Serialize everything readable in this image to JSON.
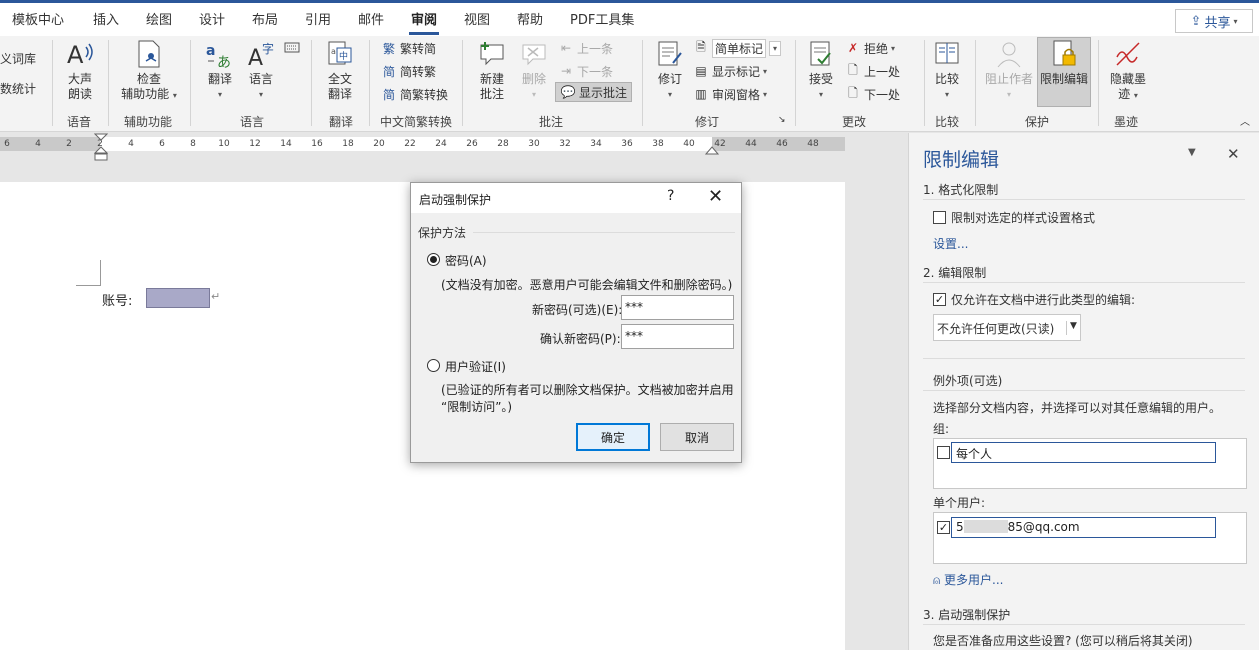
{
  "tabs": [
    "模板中心",
    "插入",
    "绘图",
    "设计",
    "布局",
    "引用",
    "邮件",
    "审阅",
    "视图",
    "帮助",
    "PDF工具集"
  ],
  "active_tab": "审阅",
  "share_label": "共享",
  "ribbon": {
    "left_partial": [
      "义词库",
      "数统计"
    ],
    "speech": {
      "btn": [
        "大声",
        "朗读"
      ],
      "label": "语音"
    },
    "accessibility": {
      "btn": [
        "检查",
        "辅助功能"
      ],
      "label": "辅助功能"
    },
    "language": {
      "translate": "翻译",
      "lang": "语言",
      "label": "语言"
    },
    "translation": {
      "btn": [
        "全文",
        "翻译"
      ],
      "label": "翻译"
    },
    "chinese": {
      "items": [
        "繁转简",
        "简转繁",
        "简繁转换"
      ],
      "label": "中文简繁转换"
    },
    "comments": {
      "new": [
        "新建",
        "批注"
      ],
      "delete": "删除",
      "prev": "上一条",
      "next": "下一条",
      "show": "显示批注",
      "label": "批注"
    },
    "tracking": {
      "track": "修订",
      "markup": "简单标记",
      "show_markup": "显示标记",
      "pane": "审阅窗格",
      "label": "修订"
    },
    "changes": {
      "accept": "接受",
      "reject": "拒绝",
      "prev": "上一处",
      "next": "下一处",
      "label": "更改"
    },
    "compare": {
      "btn": "比较",
      "label": "比较"
    },
    "protect": {
      "block": "阻止作者",
      "restrict": "限制编辑",
      "label": "保护"
    },
    "ink": {
      "btn": [
        "隐藏墨",
        "迹"
      ],
      "label": "墨迹"
    }
  },
  "ruler_ticks": [
    "6",
    "4",
    "2",
    "2",
    "4",
    "6",
    "8",
    "10",
    "12",
    "14",
    "16",
    "18",
    "20",
    "22",
    "24",
    "26",
    "28",
    "30",
    "32",
    "34",
    "36",
    "38",
    "40",
    "42",
    "44",
    "46",
    "48"
  ],
  "document": {
    "label": "账号:",
    "para_mark": "↵"
  },
  "dialog": {
    "title": "启动强制保护",
    "help": "?",
    "close": "✕",
    "section": "保护方法",
    "password_option": "密码(A)",
    "password_note": "(文档没有加密。恶意用户可能会编辑文件和删除密码。)",
    "new_pw_label": "新密码(可选)(E):",
    "new_pw_value": "***",
    "confirm_pw_label": "确认新密码(P):",
    "confirm_pw_value": "***",
    "user_auth_option": "用户验证(I)",
    "user_auth_note_1": "(已验证的所有者可以删除文档保护。文档被加密并启用",
    "user_auth_note_2": "“限制访问”。)",
    "ok": "确定",
    "cancel": "取消"
  },
  "pane": {
    "title": "限制编辑",
    "s1_title": "1. 格式化限制",
    "s1_check": "限制对选定的样式设置格式",
    "s1_link": "设置...",
    "s2_title": "2. 编辑限制",
    "s2_check": "仅允许在文档中进行此类型的编辑:",
    "s2_select": "不允许任何更改(只读)",
    "exceptions_title": "例外项(可选)",
    "exceptions_desc": "选择部分文档内容，并选择可以对其任意编辑的用户。",
    "groups_label": "组:",
    "group_item": "每个人",
    "users_label": "单个用户:",
    "user_item_prefix": "5",
    "user_item_suffix": "85@qq.com",
    "more_users": "更多用户...",
    "s3_title": "3. 启动强制保护",
    "s3_desc": "您是否准备应用这些设置? (您可以稍后将其关闭)"
  }
}
